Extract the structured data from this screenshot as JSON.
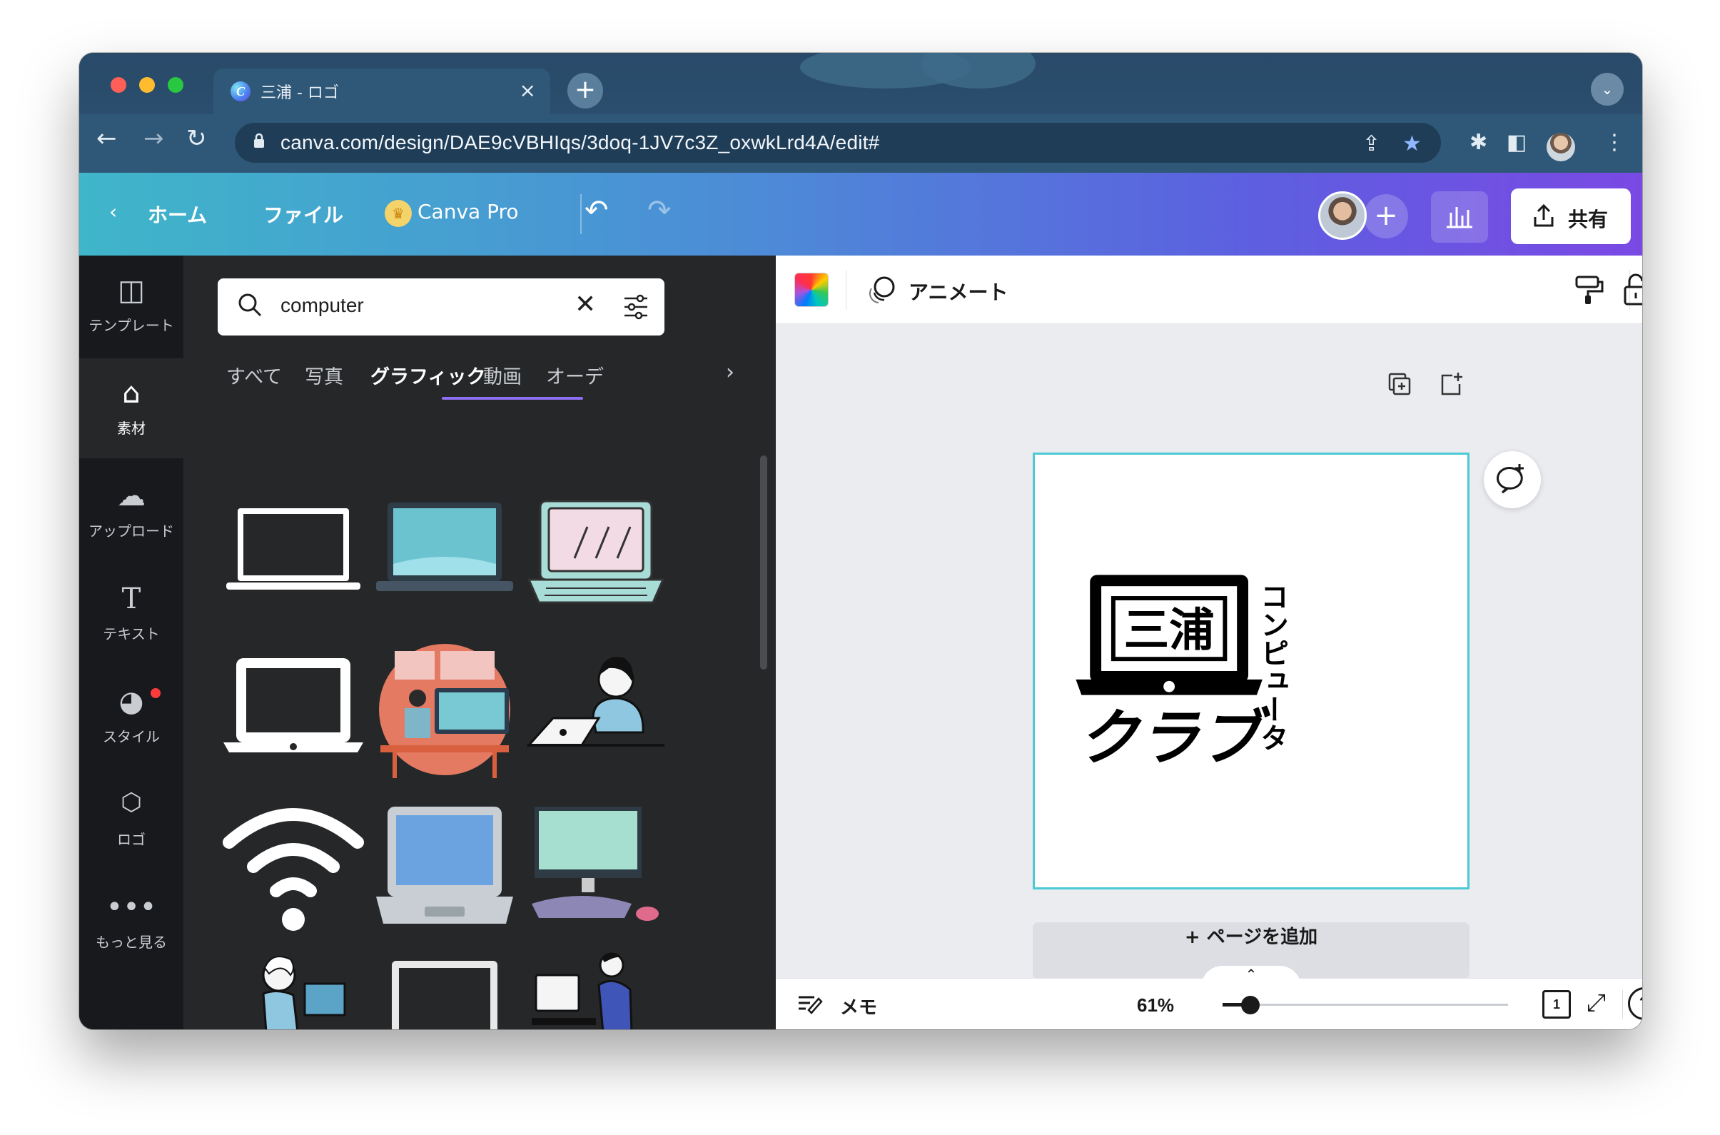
{
  "browser": {
    "tab_title": "三浦 - ロゴ",
    "tab_close": "×",
    "new_tab": "+",
    "url": "canva.com/design/DAE9cVBHIqs/3doq-1JV7c3Z_oxwkLrd4A/edit#"
  },
  "header": {
    "home": "ホーム",
    "file": "ファイル",
    "canva_pro": "Canva Pro",
    "share": "共有"
  },
  "rail": [
    {
      "label": "テンプレート",
      "icon": "template-icon"
    },
    {
      "label": "素材",
      "icon": "elements-icon"
    },
    {
      "label": "アップロード",
      "icon": "upload-icon"
    },
    {
      "label": "テキスト",
      "icon": "text-icon"
    },
    {
      "label": "スタイル",
      "icon": "palette-icon"
    },
    {
      "label": "ロゴ",
      "icon": "logo-icon"
    },
    {
      "label": "もっと見る",
      "icon": "more-icon"
    }
  ],
  "panel": {
    "search_value": "computer",
    "categories": [
      "すべて",
      "写真",
      "グラフィック",
      "動画",
      "オーデ"
    ],
    "active_category": "グラフィック"
  },
  "editor": {
    "animate": "アニメート",
    "add_page": "+ ページを追加",
    "memo": "メモ",
    "zoom": "61%",
    "page_number": "1",
    "help": "?"
  },
  "design": {
    "title_kanji": "三浦",
    "vertical_text": "コンピュータ",
    "bottom_text": "クラブ"
  }
}
